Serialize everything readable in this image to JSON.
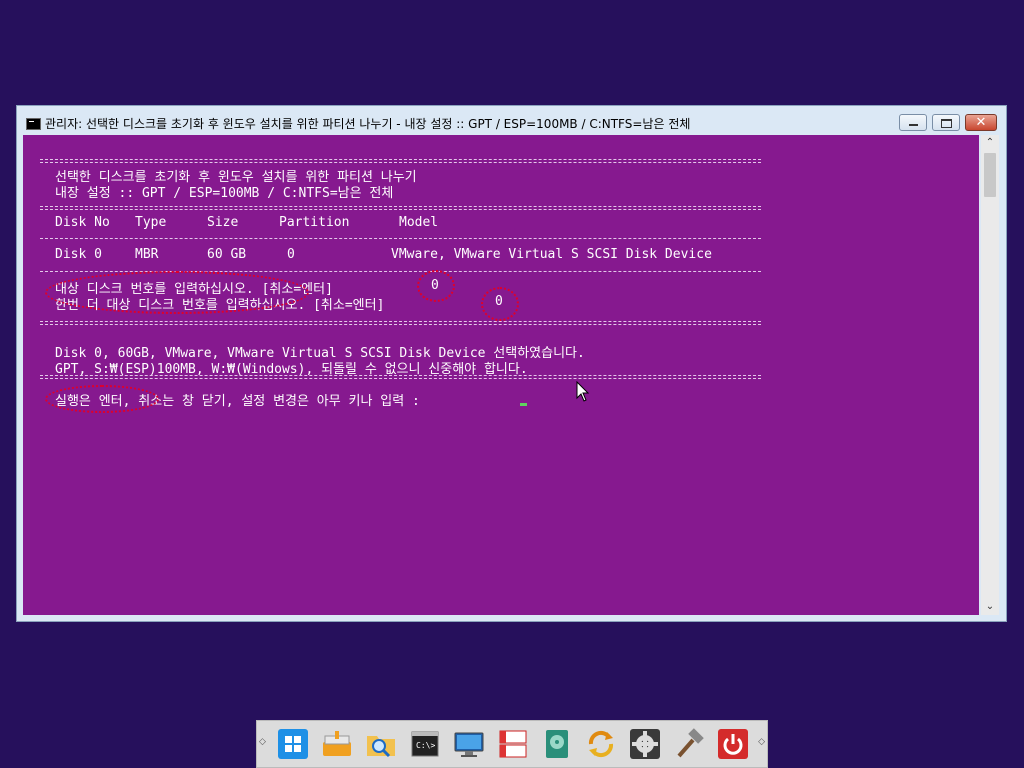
{
  "window": {
    "title": "관리자:  선택한 디스크를 초기화 후 윈도우 설치를 위한 파티션 나누기 - 내장 설정 :: GPT / ESP=100MB / C:NTFS=남은 전체",
    "close_glyph": "✕"
  },
  "console": {
    "separator_char": "=",
    "header_line1": "선택한 디스크를 초기화 후 윈도우 설치를 위한 파티션 나누기",
    "header_line2": "내장 설정 :: GPT / ESP=100MB / C:NTFS=남은 전체",
    "table": {
      "headers": [
        "Disk No",
        "Type",
        "Size",
        "Partition",
        "Model"
      ],
      "rows": [
        [
          "Disk 0",
          "MBR",
          "60 GB",
          "0",
          "VMware, VMware Virtual S SCSI Disk Device"
        ]
      ]
    },
    "prompt1_text": "대상 디스크 번호를 입력하십시오. [취소=엔터]",
    "prompt1_value": "0",
    "prompt2_text": "한번 더 대상 디스크 번호를 입력하십시오. [취소=엔터]",
    "prompt2_value": "0",
    "summary_line1": "Disk 0, 60GB, VMware, VMware Virtual S SCSI Disk Device 선택하였습니다.",
    "summary_line2": "GPT, S:₩(ESP)100MB, W:₩(Windows), 되돌릴 수 없으니 신중해야 합니다.",
    "final_prompt": "실행은 엔터, 취소는 창 닫기, 설정 변경은 아무 키나 입력 : "
  },
  "scrollbar": {
    "up": "⌃",
    "down": "⌄"
  },
  "taskbar": {
    "left_arrow": "◇",
    "right_arrow": "◇",
    "icons": [
      "windows-start-icon",
      "usb-drive-icon",
      "file-explorer-search-icon",
      "command-prompt-icon",
      "monitor-icon",
      "partition-tool-icon",
      "disk-utility-icon",
      "sync-arrows-icon",
      "settings-gear-icon",
      "tools-hammer-icon",
      "power-icon"
    ]
  },
  "colors": {
    "desktop_bg": "#26105c",
    "console_bg": "#86198f",
    "highlight_oval": "#e0002a",
    "cursor": "#5fd35f"
  }
}
